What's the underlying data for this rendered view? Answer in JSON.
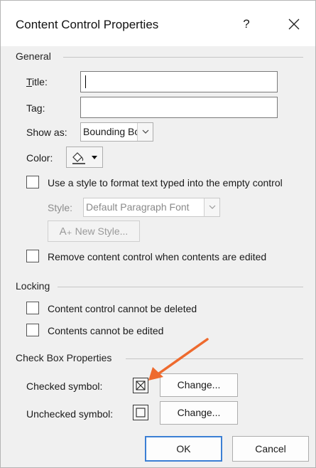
{
  "dialog": {
    "title": "Content Control Properties",
    "help_label": "?"
  },
  "general": {
    "section_label": "General",
    "title_label": "Title:",
    "title_value": "",
    "tag_label": "Tag:",
    "tag_value": "",
    "show_as_label": "Show as:",
    "show_as_value": "Bounding Box",
    "color_label": "Color:",
    "use_style_label": "Use a style to format text typed into the empty control",
    "use_style_checked": false,
    "style_label": "Style:",
    "style_value": "Default Paragraph Font",
    "new_style_label": "New Style...",
    "remove_label": "Remove content control when contents are edited",
    "remove_checked": false
  },
  "locking": {
    "section_label": "Locking",
    "cannot_delete_label": "Content control cannot be deleted",
    "cannot_delete_checked": false,
    "cannot_edit_label": "Contents cannot be edited",
    "cannot_edit_checked": false
  },
  "checkbox_props": {
    "section_label": "Check Box Properties",
    "checked_label": "Checked symbol:",
    "checked_symbol": "☒",
    "checked_change_label": "Change...",
    "unchecked_label": "Unchecked symbol:",
    "unchecked_symbol": "☐",
    "unchecked_change_label": "Change..."
  },
  "footer": {
    "ok_label": "OK",
    "cancel_label": "Cancel"
  },
  "colors": {
    "annotation_arrow": "#ee6a2e",
    "default_button_border": "#3b7fd4"
  }
}
